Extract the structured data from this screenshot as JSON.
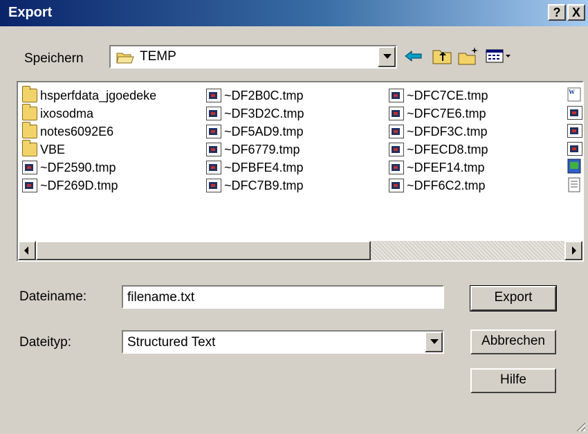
{
  "window": {
    "title": "Export",
    "help_button": "?",
    "close_button": "X"
  },
  "location": {
    "label": "Speichern",
    "value": "TEMP"
  },
  "toolbar": {
    "icons": [
      "back-arrow-icon",
      "up-folder-icon",
      "new-folder-icon",
      "view-menu-icon"
    ]
  },
  "files": [
    {
      "name": "hsperfdata_jgoedeke",
      "type": "folder"
    },
    {
      "name": "ixosodma",
      "type": "folder"
    },
    {
      "name": "notes6092E6",
      "type": "folder"
    },
    {
      "name": "VBE",
      "type": "folder"
    },
    {
      "name": "~DF2590.tmp",
      "type": "tmp"
    },
    {
      "name": "~DF269D.tmp",
      "type": "tmp"
    },
    {
      "name": "~DF2B0C.tmp",
      "type": "tmp"
    },
    {
      "name": "~DF3D2C.tmp",
      "type": "tmp"
    },
    {
      "name": "~DF5AD9.tmp",
      "type": "tmp"
    },
    {
      "name": "~DF6779.tmp",
      "type": "tmp"
    },
    {
      "name": "~DFBFE4.tmp",
      "type": "tmp"
    },
    {
      "name": "~DFC7B9.tmp",
      "type": "tmp"
    },
    {
      "name": "~DFC7CE.tmp",
      "type": "tmp"
    },
    {
      "name": "~DFC7E6.tmp",
      "type": "tmp"
    },
    {
      "name": "~DFDF3C.tmp",
      "type": "tmp"
    },
    {
      "name": "~DFECD8.tmp",
      "type": "tmp"
    },
    {
      "name": "~DFEF14.tmp",
      "type": "tmp"
    },
    {
      "name": "~DFF6C2.tmp",
      "type": "tmp"
    }
  ],
  "filename": {
    "label": "Dateiname:",
    "value": "filename.txt"
  },
  "filetype": {
    "label": "Dateityp:",
    "value": "Structured Text"
  },
  "buttons": {
    "export": "Export",
    "cancel": "Abbrechen",
    "help": "Hilfe"
  }
}
